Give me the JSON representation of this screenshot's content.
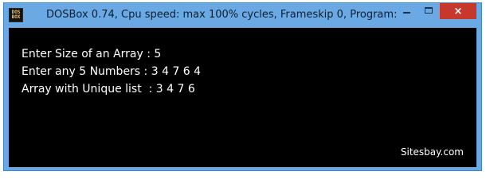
{
  "window": {
    "title": "DOSBox 0.74, Cpu speed: max 100% cycles, Frameskip  0, Program:",
    "icon": {
      "name": "dosbox-icon",
      "line1": "DOS",
      "line2": "BOX"
    },
    "controls": {
      "minimize": "minimize-icon",
      "maximize": "maximize-icon",
      "close": "×"
    }
  },
  "console": {
    "lines": [
      "Enter Size of an Array : 5",
      "Enter any 5 Numbers : 3 4 7 6 4",
      "Array with Unique list  : 3 4 7 6"
    ],
    "watermark": "Sitesbay.com"
  },
  "colors": {
    "frame": "#6aa9e3",
    "close": "#c7372b",
    "console_bg": "#000000",
    "console_text": "#ffffff"
  }
}
